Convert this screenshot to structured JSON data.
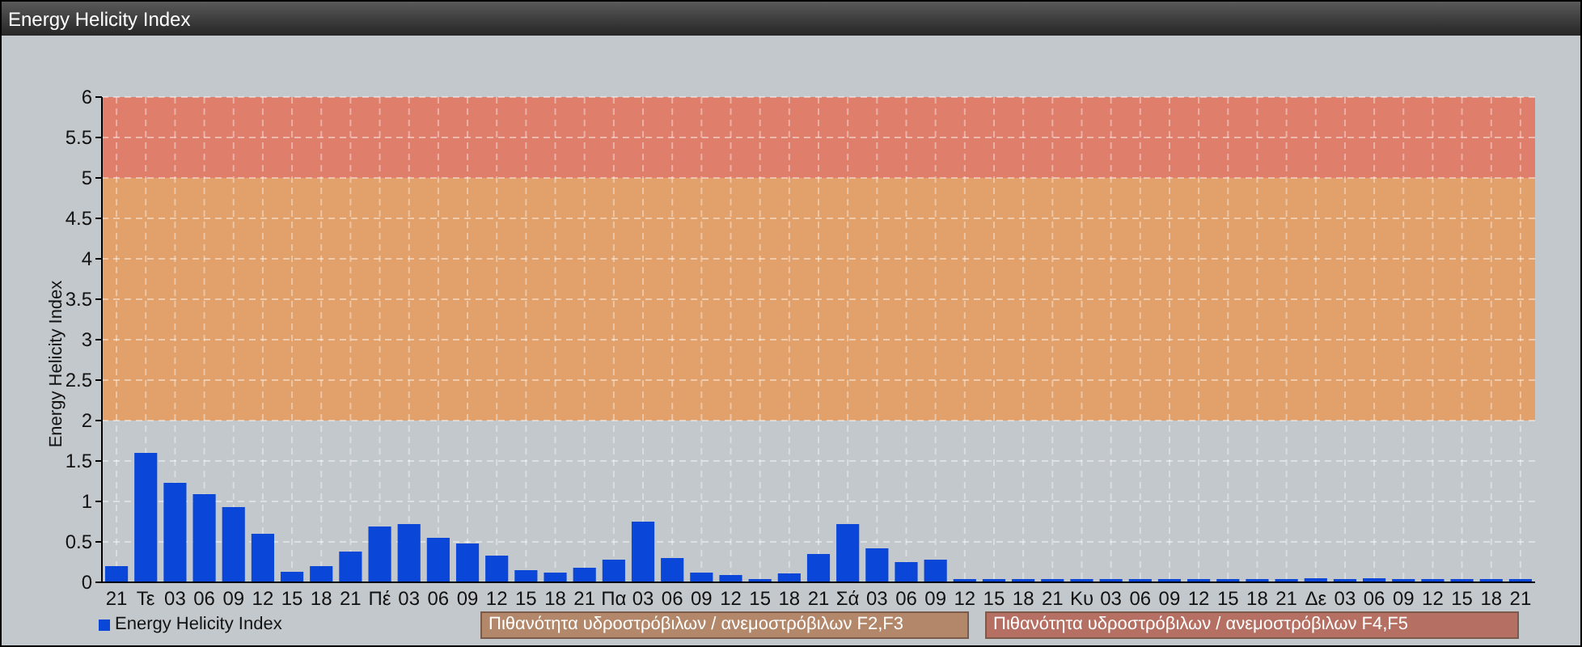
{
  "window": {
    "title": "Energy Helicity Index"
  },
  "chart": {
    "chart_data": {
      "type": "bar",
      "ylabel": "Energy Helicity Index",
      "ylim": [
        0,
        6
      ],
      "yticks": [
        0,
        0.5,
        1,
        1.5,
        2,
        2.5,
        3,
        3.5,
        4,
        4.5,
        5,
        5.5,
        6
      ],
      "grid": true,
      "categories": [
        "21",
        "Τε",
        "03",
        "06",
        "09",
        "12",
        "15",
        "18",
        "21",
        "Πέ",
        "03",
        "06",
        "09",
        "12",
        "15",
        "18",
        "21",
        "Πα",
        "03",
        "06",
        "09",
        "12",
        "15",
        "18",
        "21",
        "Σά",
        "03",
        "06",
        "09",
        "12",
        "15",
        "18",
        "21",
        "Κυ",
        "03",
        "06",
        "09",
        "12",
        "15",
        "18",
        "21",
        "Δε",
        "03",
        "06",
        "09",
        "12",
        "15",
        "18",
        "21"
      ],
      "series": [
        {
          "name": "Energy Helicity Index",
          "color": "#0a47d8",
          "values": [
            0.2,
            1.6,
            1.23,
            1.09,
            0.93,
            0.6,
            0.13,
            0.2,
            0.38,
            0.69,
            0.72,
            0.55,
            0.48,
            0.33,
            0.15,
            0.12,
            0.18,
            0.28,
            0.75,
            0.3,
            0.12,
            0.09,
            0.03,
            0.11,
            0.35,
            0.72,
            0.42,
            0.25,
            0.28,
            0.03,
            0.02,
            0.04,
            0.02,
            0.02,
            0.02,
            0.02,
            0.02,
            0.02,
            0.02,
            0.02,
            0.03,
            0.05,
            0.04,
            0.05,
            0.02,
            0.02,
            0.04,
            0.03,
            0.03
          ]
        }
      ],
      "bands": [
        {
          "axis": "y",
          "from": 2,
          "to": 5,
          "color": "#e2a06a"
        },
        {
          "axis": "y",
          "from": 5,
          "to": 6,
          "color": "#e07e6c"
        }
      ]
    },
    "band_legend": [
      {
        "label": "Πιθανότητα υδροστρόβιλων / ανεμοστρόβιλων F2,F3",
        "color": "#b3876a"
      },
      {
        "label": "Πιθανότητα υδροστρόβιλων / ανεμοστρόβιλων F4,F5",
        "color": "#b57063"
      }
    ]
  }
}
